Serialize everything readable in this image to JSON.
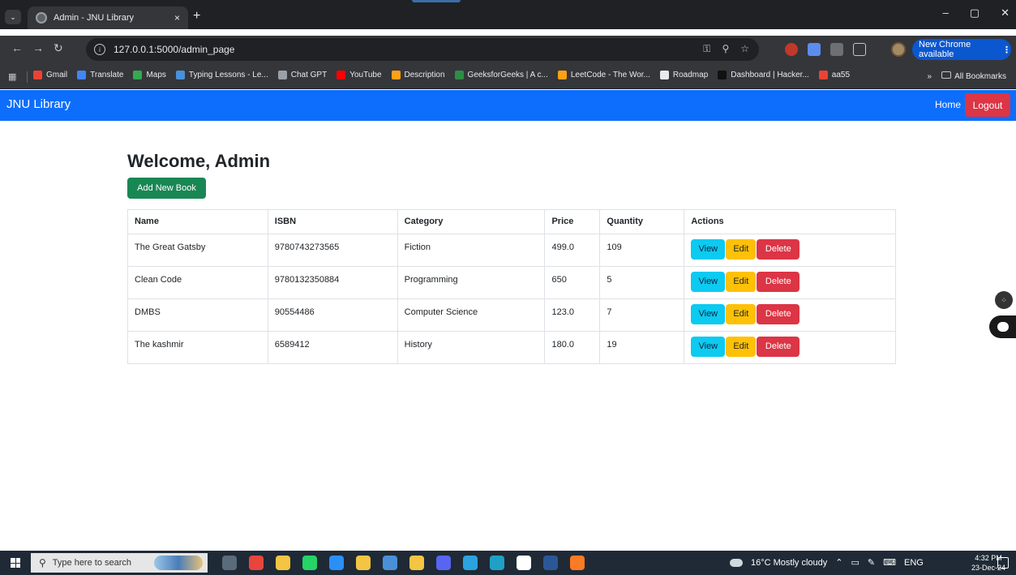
{
  "browser": {
    "tab_title": "Admin - JNU Library",
    "tab_close": "×",
    "new_tab": "+",
    "url": "127.0.0.1:5000/admin_page",
    "update_label": "New Chrome available",
    "update_dots": "⋮",
    "window_controls": [
      "–",
      "▢",
      "✕"
    ]
  },
  "bookmarks": {
    "items": [
      {
        "label": "Gmail",
        "color": "#ea4335"
      },
      {
        "label": "Translate",
        "color": "#4285f4"
      },
      {
        "label": "Maps",
        "color": "#34a853"
      },
      {
        "label": "Typing Lessons - Le...",
        "color": "#4a90d9"
      },
      {
        "label": "Chat GPT",
        "color": "#9aa0a6"
      },
      {
        "label": "YouTube",
        "color": "#ff0000"
      },
      {
        "label": "Description",
        "color": "#ffa116"
      },
      {
        "label": "GeeksforGeeks | A c...",
        "color": "#2f8d46"
      },
      {
        "label": "LeetCode - The Wor...",
        "color": "#ffa116"
      },
      {
        "label": "Roadmap",
        "color": "#e8eaed"
      },
      {
        "label": "Dashboard | Hacker...",
        "color": "#111111"
      },
      {
        "label": "aa55",
        "color": "#ea4335"
      }
    ],
    "more": "»",
    "all_bookmarks": "All Bookmarks"
  },
  "navbar": {
    "brand": "JNU Library",
    "home": "Home",
    "logout": "Logout"
  },
  "main": {
    "welcome": "Welcome, Admin",
    "add_button": "Add New Book"
  },
  "table": {
    "headers": [
      "Name",
      "ISBN",
      "Category",
      "Price",
      "Quantity",
      "Actions"
    ],
    "rows": [
      {
        "name": "The Great Gatsby",
        "isbn": "9780743273565",
        "category": "Fiction",
        "price": "499.0",
        "quantity": "109"
      },
      {
        "name": "Clean Code",
        "isbn": "9780132350884",
        "category": "Programming",
        "price": "650",
        "quantity": "5"
      },
      {
        "name": "DMBS",
        "isbn": "90554486",
        "category": "Computer Science",
        "price": "123.0",
        "quantity": "7"
      },
      {
        "name": "The kashmir",
        "isbn": "6589412",
        "category": "History",
        "price": "180.0",
        "quantity": "19"
      }
    ],
    "actions": {
      "view": "View",
      "edit": "Edit",
      "delete": "Delete"
    }
  },
  "taskbar": {
    "search_placeholder": "Type here to search",
    "weather": "16°C  Mostly cloudy",
    "lang": "ENG",
    "time": "4:32 PM",
    "date": "23-Dec-24",
    "apps": [
      {
        "name": "task-view",
        "color": "#5a6b7b"
      },
      {
        "name": "chrome",
        "color": "#e8453c"
      },
      {
        "name": "file-explorer",
        "color": "#f4c542"
      },
      {
        "name": "whatsapp",
        "color": "#25d366"
      },
      {
        "name": "vscode",
        "color": "#2a8ff7"
      },
      {
        "name": "store",
        "color": "#f4c542"
      },
      {
        "name": "pen",
        "color": "#4a90d9"
      },
      {
        "name": "notes",
        "color": "#f4c542"
      },
      {
        "name": "discord",
        "color": "#5865f2"
      },
      {
        "name": "telegram",
        "color": "#2aa3e0"
      },
      {
        "name": "edge",
        "color": "#1fa1c6"
      },
      {
        "name": "mongodb",
        "color": "#ffffff"
      },
      {
        "name": "word",
        "color": "#2b5797"
      },
      {
        "name": "xampp",
        "color": "#fb7a24"
      }
    ]
  }
}
